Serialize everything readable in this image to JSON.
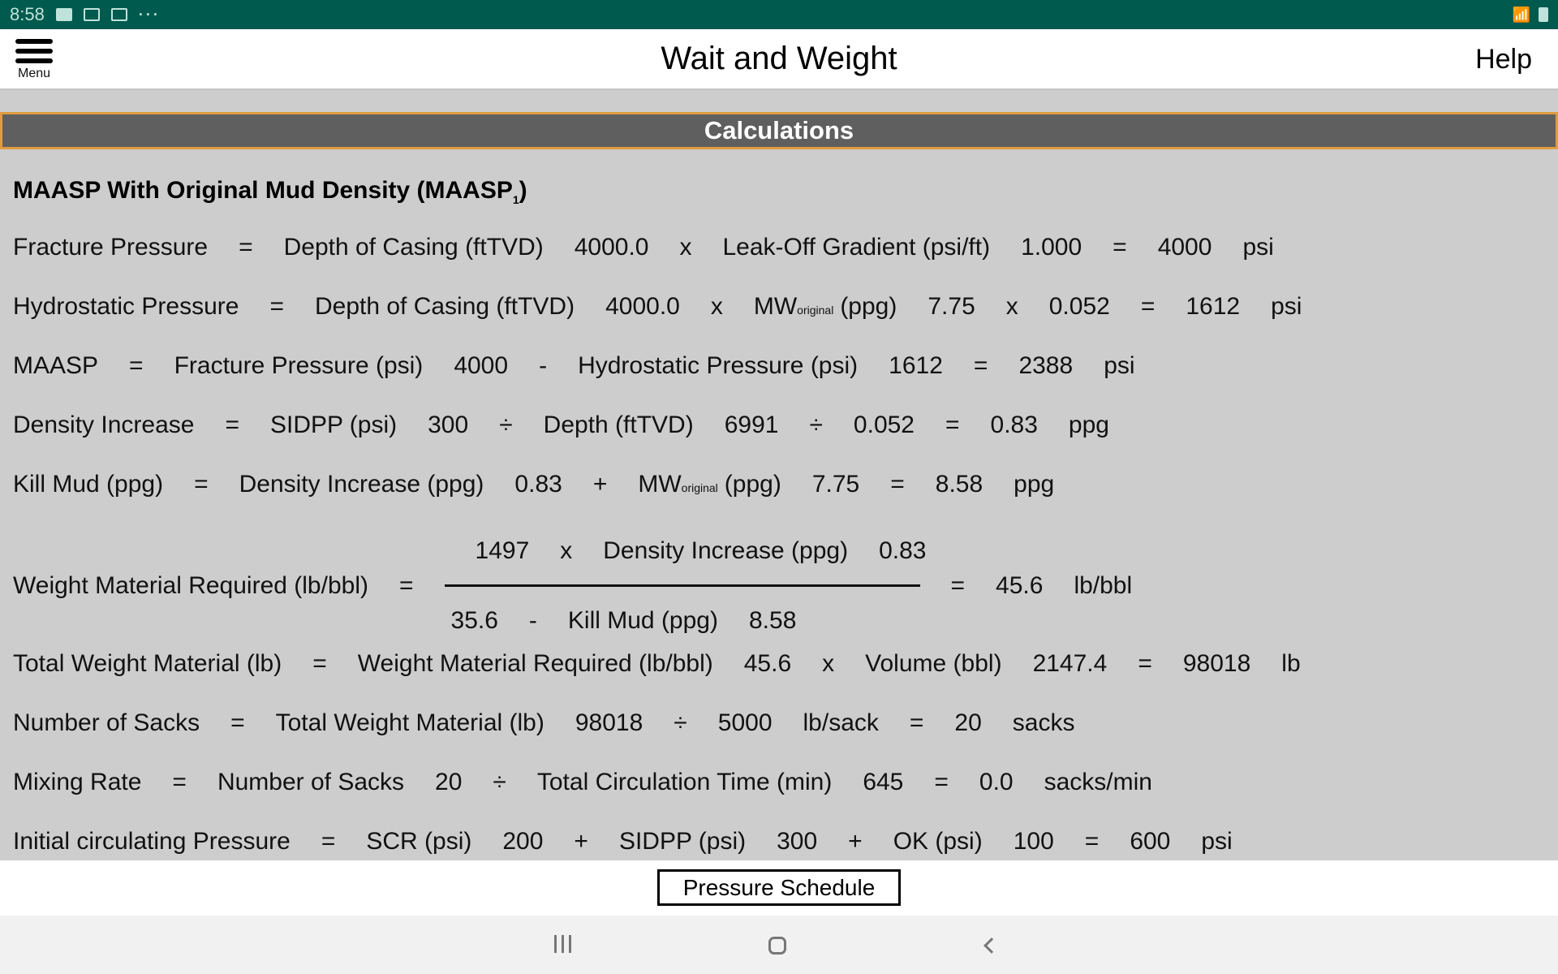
{
  "status_bar": {
    "time": "8:58",
    "left_icons": [
      "gallery-icon",
      "mail-x-icon",
      "gmail-icon",
      "more-dots-icon"
    ],
    "right_icons": [
      "wifi-icon",
      "battery-icon"
    ]
  },
  "header": {
    "menu_label": "Menu",
    "title": "Wait and Weight",
    "help_label": "Help"
  },
  "section": {
    "title": "Calculations"
  },
  "heading": {
    "text": "MAASP With Original Mud Density (MAASP",
    "subscript": "1",
    "close": ")"
  },
  "rows": {
    "fracture": [
      "Fracture Pressure",
      "=",
      "Depth of Casing (ftTVD)",
      "4000.0",
      "x",
      "Leak-Off Gradient (psi/ft)",
      "1.000",
      "=",
      "4000",
      "psi"
    ],
    "hydrostatic": {
      "a": [
        "Hydrostatic Pressure",
        "=",
        "Depth of Casing (ftTVD)",
        "4000.0",
        "x"
      ],
      "mw": "MW",
      "mw_sub": "original",
      "b": [
        "(ppg)",
        "7.75",
        "x",
        "0.052",
        "=",
        "1612",
        "psi"
      ]
    },
    "maasp": [
      "MAASP",
      "=",
      "Fracture Pressure (psi)",
      "4000",
      "-",
      "Hydrostatic Pressure (psi)",
      "1612",
      "=",
      "2388",
      "psi"
    ],
    "density_increase": [
      "Density Increase",
      "=",
      "SIDPP (psi)",
      "300",
      "÷",
      "Depth (ftTVD)",
      "6991",
      "÷",
      "0.052",
      "=",
      "0.83",
      "ppg"
    ],
    "kill_mud": {
      "a": [
        "Kill Mud (ppg)",
        "=",
        "Density Increase (ppg)",
        "0.83",
        "+"
      ],
      "mw": "MW",
      "mw_sub": "original",
      "b": [
        "(ppg)",
        "7.75",
        "=",
        "8.58",
        "ppg"
      ]
    },
    "weight_material": {
      "label": "Weight Material Required (lb/bbl)",
      "eq": "=",
      "numerator": [
        "1497",
        "x",
        "Density Increase (ppg)",
        "0.83"
      ],
      "denominator": [
        "35.6",
        "-",
        "Kill Mud (ppg)",
        "8.58"
      ],
      "eq2": "=",
      "result": "45.6",
      "unit": "lb/bbl"
    },
    "total_weight": [
      "Total Weight Material (lb)",
      "=",
      "Weight Material Required (lb/bbl)",
      "45.6",
      "x",
      "Volume (bbl)",
      "2147.4",
      "=",
      "98018",
      "lb"
    ],
    "sacks": [
      "Number of Sacks",
      "=",
      "Total Weight Material (lb)",
      "98018",
      "÷",
      "5000",
      "lb/sack",
      "=",
      "20",
      "sacks"
    ],
    "mixing_rate": [
      "Mixing Rate",
      "=",
      "Number of Sacks",
      "20",
      "÷",
      "Total Circulation Time (min)",
      "645",
      "=",
      "0.0",
      "sacks/min"
    ],
    "icp": [
      "Initial circulating Pressure",
      "=",
      "SCR (psi)",
      "200",
      "+",
      "SIDPP (psi)",
      "300",
      "+",
      "OK (psi)",
      "100",
      "=",
      "600",
      "psi"
    ]
  },
  "footer": {
    "pressure_schedule_label": "Pressure Schedule"
  },
  "nav": [
    "recent-apps",
    "home",
    "back"
  ],
  "colors": {
    "status_bar": "#005a4e",
    "section_bar": "#5f5f5f",
    "section_border": "#e09b3e",
    "content_bg": "#cdcdcd"
  }
}
